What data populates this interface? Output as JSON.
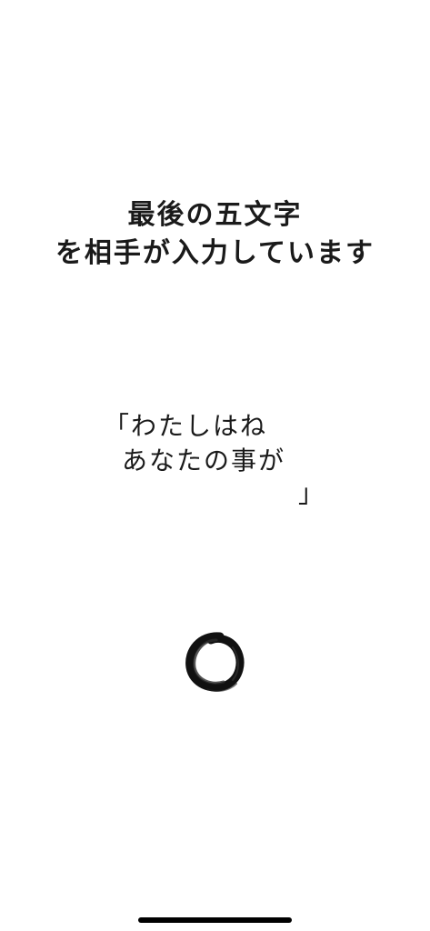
{
  "status": {
    "line1": "最後の五文字",
    "line2": "を相手が入力しています"
  },
  "poem": {
    "open_bracket": "「",
    "line1": "わたしはね",
    "line2": "あなたの事が",
    "close_bracket": "」"
  },
  "loader": {
    "icon": "enso-brush-circle-icon"
  }
}
